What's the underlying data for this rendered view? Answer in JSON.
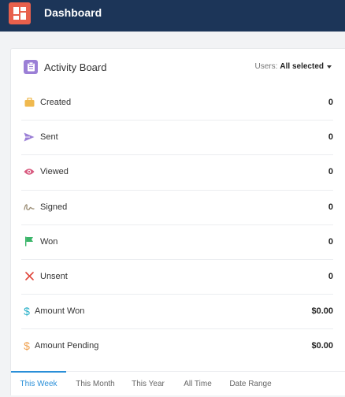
{
  "header": {
    "title": "Dashboard",
    "logo_icon": "dashboard-grid-icon",
    "logo_color": "#e8604c",
    "background_color": "#1c3558"
  },
  "board": {
    "title": "Activity Board",
    "icon": "clipboard-icon",
    "icon_color": "#9b7fd6",
    "users_label": "Users:",
    "users_value": "All selected"
  },
  "metrics": [
    {
      "label": "Created",
      "value": "0",
      "icon": "briefcase-icon",
      "color": "#f0b94e"
    },
    {
      "label": "Sent",
      "value": "0",
      "icon": "paper-plane-icon",
      "color": "#9b7fd6"
    },
    {
      "label": "Viewed",
      "value": "0",
      "icon": "eye-icon",
      "color": "#d85a7f"
    },
    {
      "label": "Signed",
      "value": "0",
      "icon": "signature-icon",
      "color": "#9a8c74"
    },
    {
      "label": "Won",
      "value": "0",
      "icon": "flag-icon",
      "color": "#3bb56a"
    },
    {
      "label": "Unsent",
      "value": "0",
      "icon": "x-icon",
      "color": "#e0483d"
    },
    {
      "label": "Amount Won",
      "value": "$0.00",
      "icon": "dollar-icon",
      "color": "#2ab0c8",
      "glyph": "$"
    },
    {
      "label": "Amount Pending",
      "value": "$0.00",
      "icon": "dollar-icon",
      "color": "#f0a04e",
      "glyph": "$"
    }
  ],
  "tabs": [
    {
      "label": "This Week",
      "active": true
    },
    {
      "label": "This Month",
      "active": false
    },
    {
      "label": "This Year",
      "active": false
    },
    {
      "label": "All Time",
      "active": false
    },
    {
      "label": "Date Range",
      "active": false
    }
  ],
  "accent_color": "#2a8fd8"
}
